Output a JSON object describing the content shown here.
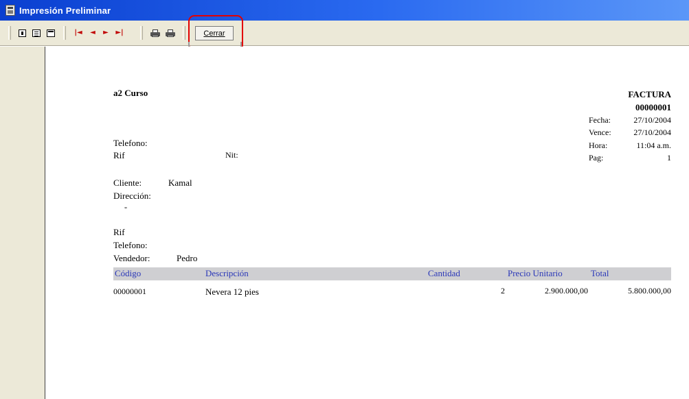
{
  "window": {
    "title": "Impresión Preliminar"
  },
  "toolbar": {
    "buttons": [
      {
        "name": "one-page-view"
      },
      {
        "name": "two-page-view"
      },
      {
        "name": "page-width-view"
      },
      {
        "name": "first-page",
        "glyph": "|◄"
      },
      {
        "name": "prev-page",
        "glyph": "◄"
      },
      {
        "name": "next-page",
        "glyph": "►"
      },
      {
        "name": "last-page",
        "glyph": "►|"
      },
      {
        "name": "print-setup"
      },
      {
        "name": "print"
      }
    ],
    "close_label": "Cerrar"
  },
  "invoice": {
    "company": "a2 Curso",
    "doc_type": "FACTURA",
    "doc_number": "00000001",
    "fecha_label": "Fecha:",
    "fecha": "27/10/2004",
    "vence_label": "Vence:",
    "vence": "27/10/2004",
    "hora_label": "Hora:",
    "hora": "11:04 a.m.",
    "pag_label": "Pag:",
    "pag": "1",
    "telefono_label": "Telefono:",
    "rif_label": "Rif",
    "nit_label": "Nit:",
    "cliente_label": "Cliente:",
    "cliente": "Kamal",
    "direccion_label": "Dirección:",
    "direccion_mark": "\"",
    "cliente_rif_label": "Rif",
    "cliente_telefono_label": "Telefono:",
    "vendedor_label": "Vendedor:",
    "vendedor": "Pedro",
    "columns": {
      "codigo": "Código",
      "descripcion": "Descripción",
      "cantidad": "Cantidad",
      "precio": "Precio Unitario",
      "total": "Total"
    },
    "rows": [
      {
        "codigo": "00000001",
        "descripcion": "Nevera 12 pies",
        "cantidad": "2",
        "precio": "2.900.000,00",
        "total": "5.800.000,00"
      }
    ]
  },
  "colors": {
    "titlebar_start": "#0a3fd0",
    "titlebar_end": "#5b97f8",
    "toolbar_bg": "#ece9d8",
    "header_row_bg": "#cfcfd2",
    "header_text": "#2a37b8",
    "highlight": "#e30000"
  }
}
